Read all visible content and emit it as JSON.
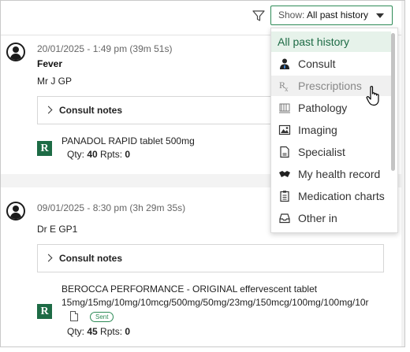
{
  "toolbar": {
    "show_prefix": "Show: ",
    "show_value": "All past history",
    "filter_icon": "funnel-icon"
  },
  "records": [
    {
      "date": "20/01/2025 - 1:49 pm (39m 51s)",
      "title": "Fever",
      "doctor": "Mr J GP",
      "notes_label": "Consult notes",
      "rx_badge": "R",
      "drug": "PANADOL RAPID tablet 500mg",
      "qty_label": "Qty: ",
      "qty": "40",
      "rpts_label": " Rpts: ",
      "rpts": "0"
    },
    {
      "date": "09/01/2025 - 8:30 pm (3h 29m 35s)",
      "doctor": "Dr E GP1",
      "notes_label": "Consult notes",
      "rx_badge": "R",
      "drug_line1": "BEROCCA PERFORMANCE - ORIGINAL effervescent tablet",
      "drug_line2": "15mg/15mg/10mg/10mcg/500mg/50mg/23mg/150mcg/100mg/100mg/10r",
      "sent_badge": "Sent",
      "qty_label": "Qty: ",
      "qty": "45",
      "rpts_label": " Rpts: ",
      "rpts": "0"
    }
  ],
  "dropdown": {
    "items": [
      {
        "label": "All past history",
        "icon": ""
      },
      {
        "label": "Consult",
        "icon": "doctor-icon"
      },
      {
        "label": "Prescriptions",
        "icon": "rx-icon"
      },
      {
        "label": "Pathology",
        "icon": "microscope-icon"
      },
      {
        "label": "Imaging",
        "icon": "image-icon"
      },
      {
        "label": "Specialist",
        "icon": "document-icon"
      },
      {
        "label": "My health record",
        "icon": "handshake-icon"
      },
      {
        "label": "Medication charts",
        "icon": "clipboard-icon"
      },
      {
        "label": "Other in",
        "icon": "inbox-icon"
      }
    ],
    "selected": "All past history",
    "hovered": "Prescriptions"
  },
  "colors": {
    "accent": "#2e8b57",
    "rx_badge": "#1d6b45",
    "selected_bg": "#e6f2ea"
  }
}
